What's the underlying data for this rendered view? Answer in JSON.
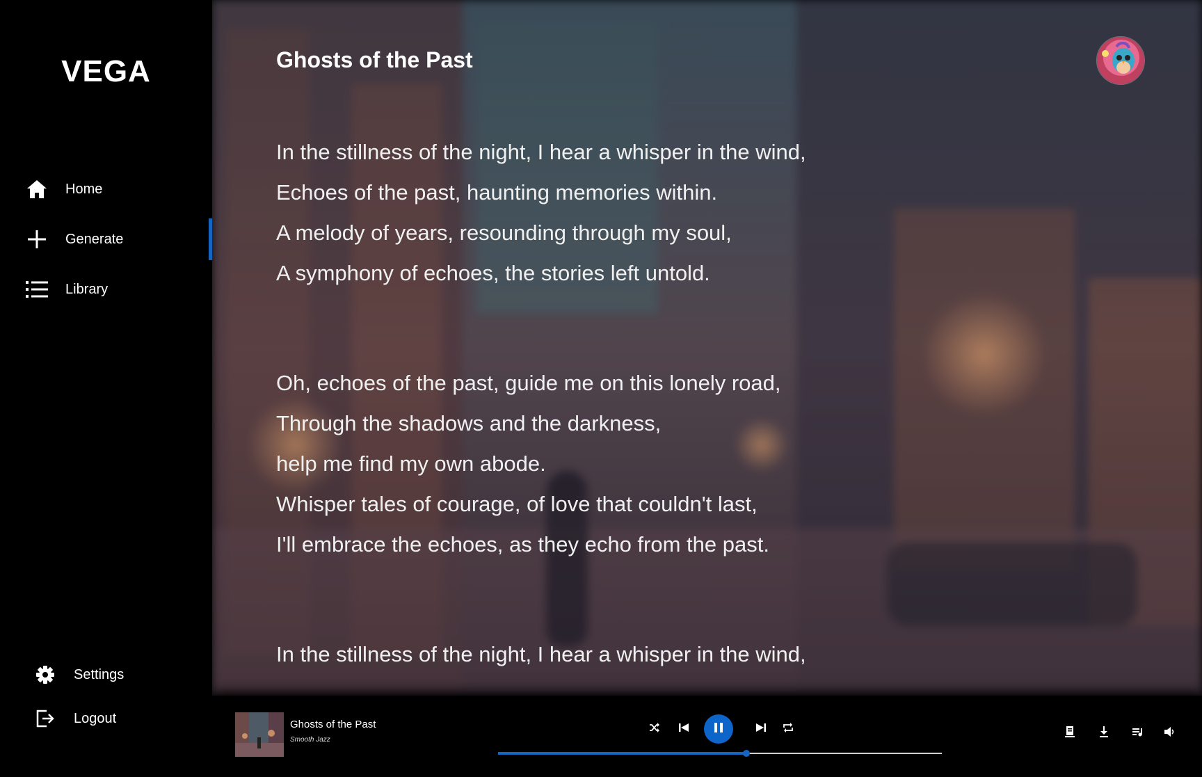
{
  "app": {
    "brand": "VEGA",
    "accent": "#1565c0"
  },
  "sidebar": {
    "items": [
      {
        "label": "Home",
        "icon": "home-icon"
      },
      {
        "label": "Generate",
        "icon": "plus-icon",
        "active": true
      },
      {
        "label": "Library",
        "icon": "list-icon"
      }
    ],
    "bottom": [
      {
        "label": "Settings",
        "icon": "gear-icon"
      },
      {
        "label": "Logout",
        "icon": "logout-icon"
      }
    ]
  },
  "song": {
    "title": "Ghosts of the Past",
    "stanzas": [
      [
        "In the stillness of the night, I hear a whisper in the wind,",
        "Echoes of the past, haunting memories within.",
        "A melody of years, resounding through my soul,",
        "A symphony of echoes, the stories left untold."
      ],
      [
        "Oh, echoes of the past, guide me on this lonely road,",
        "Through the shadows and the darkness,",
        "help me find my own abode.",
        "Whisper tales of courage, of love that couldn't last,",
        "I'll embrace the echoes, as they echo from the past."
      ],
      [
        "In the stillness of the night, I hear a whisper in the wind,"
      ]
    ]
  },
  "player": {
    "title": "Ghosts of the Past",
    "genre": "Smooth Jazz",
    "progress": 0.56,
    "controls": [
      "shuffle-icon",
      "previous-icon",
      "pause-icon",
      "next-icon",
      "repeat-icon"
    ],
    "right_controls": [
      "lyrics-icon",
      "download-icon",
      "queue-icon",
      "volume-icon"
    ]
  }
}
